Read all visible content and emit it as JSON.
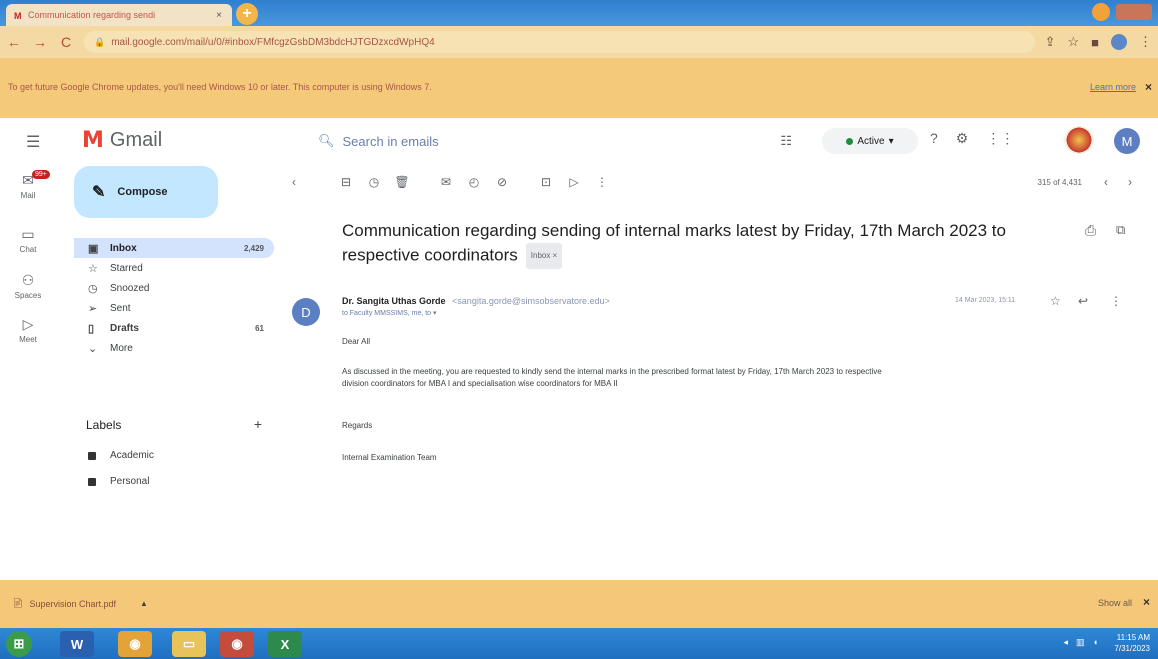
{
  "browser": {
    "tab_title": "Communication regarding sendi",
    "tab_close": "×",
    "new_tab": "+",
    "url": "mail.google.com/mail/u/0/#inbox/FMfcgzGsbDM3bdcHJTGDzxcdWpHQ4",
    "back": "←",
    "forward": "→",
    "reload": "C",
    "infobar_text": "To get future Google Chrome updates, you'll need Windows 10 or later. This computer is using Windows 7.",
    "infobar_link": "Learn more",
    "infobar_close": "×"
  },
  "gmail": {
    "logo_letter": "M",
    "logo_text": "Gmail",
    "search_placeholder": "Search in emails",
    "status": "Active",
    "user_initial": "M"
  },
  "rail": [
    {
      "label": "Mail",
      "icon": "mail-icon",
      "badge": "99+"
    },
    {
      "label": "Chat",
      "icon": "chat-icon"
    },
    {
      "label": "Spaces",
      "icon": "spaces-icon"
    },
    {
      "label": "Meet",
      "icon": "meet-icon"
    }
  ],
  "sidebar": {
    "compose": "Compose",
    "items": [
      {
        "label": "Inbox",
        "count": "2,429",
        "icon": "inbox-icon"
      },
      {
        "label": "Starred",
        "count": "",
        "icon": "star-icon"
      },
      {
        "label": "Snoozed",
        "count": "",
        "icon": "clock-icon"
      },
      {
        "label": "Sent",
        "count": "",
        "icon": "send-icon"
      },
      {
        "label": "Drafts",
        "count": "61",
        "icon": "draft-icon"
      },
      {
        "label": "More",
        "count": "",
        "icon": "chevron-down-icon"
      }
    ],
    "labels_title": "Labels",
    "labels": [
      "Academic",
      "Personal"
    ]
  },
  "toolbar": {
    "page_info": "315 of 4,431"
  },
  "email": {
    "subject": "Communication regarding sending of internal marks latest by Friday, 17th March 2023 to respective coordinators",
    "chip": "Inbox ×",
    "sender_name": "Dr. Sangita Uthas Gorde",
    "sender_email": "<sangita.gorde@simsobservatore.edu>",
    "to": "to Faculty MMSSIMS, me, to ▾",
    "date": "14 Mar 2023, 15:11",
    "greeting": "Dear All",
    "body_line1": "As discussed in the meeting, you are requested to kindly send the internal marks in the prescribed format latest by Friday, 17th March 2023 to respective",
    "body_line2": "division coordinators for MBA I and specialisation wise coordinators for MBA II",
    "regards": "Regards",
    "signature": "Internal Examination Team"
  },
  "downloads": {
    "file": "Supervision Chart.pdf",
    "show_all": "Show all",
    "close": "×"
  },
  "taskbar": {
    "time": "11:15 AM",
    "date": "7/31/2023"
  },
  "colors": {
    "chrome_tab_bar": "#2f7fd0",
    "infobar": "#f5c97a",
    "compose": "#c2e7ff",
    "inbox_active": "#d3e3fd",
    "taskbar": "#1f6fc0"
  }
}
